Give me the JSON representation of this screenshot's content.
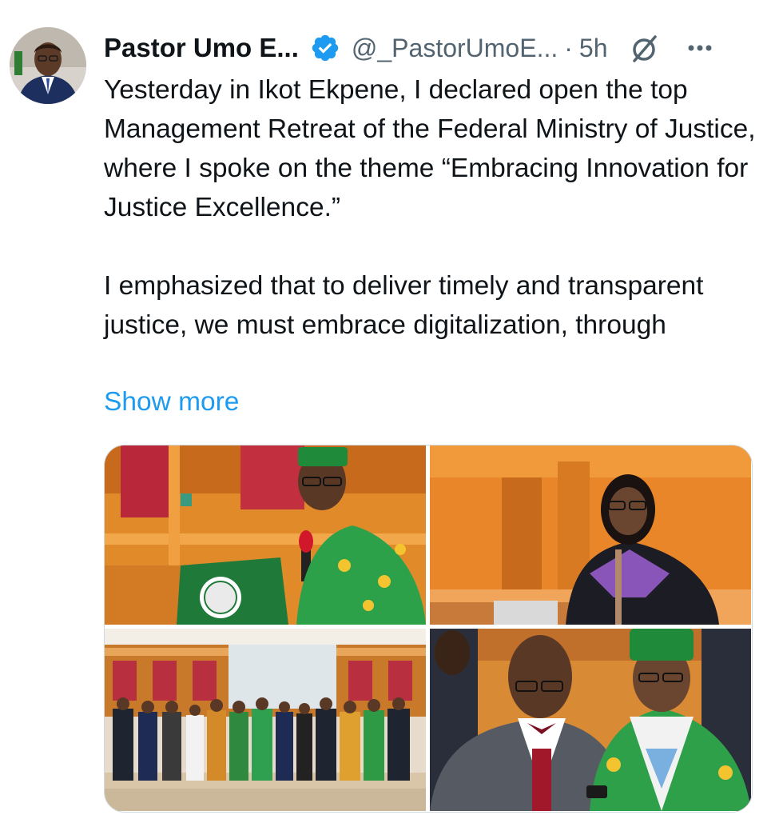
{
  "author": {
    "name": "Pastor Umo E...",
    "handle": "@_PastorUmoE...",
    "separator": "·",
    "time": "5h"
  },
  "icons": {
    "verified": "verified-badge-icon",
    "grok": "grok-icon",
    "more": "more-options-icon"
  },
  "tweet": {
    "paragraph1": "Yesterday in Ikot Ekpene, I declared open the top Management Retreat of the Federal Ministry of Justice, where I spoke on the theme “Embracing Innovation for Justice Excellence.”",
    "paragraph2": "I emphasized that to deliver timely and transparent justice, we must embrace digitalization, through",
    "show_more": "Show more"
  },
  "colors": {
    "link": "#1d9bf0",
    "verified": "#1d9bf0",
    "secondary_text": "#536471"
  }
}
